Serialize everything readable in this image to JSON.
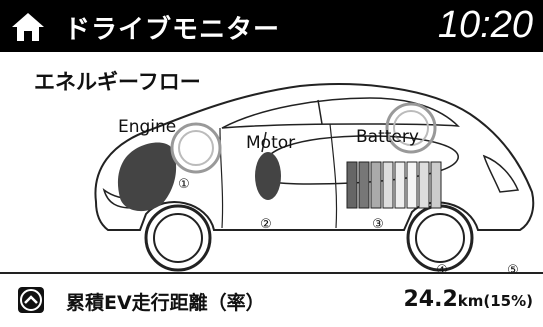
{
  "header": {
    "home_icon": "home-icon",
    "title": "ドライブモニター",
    "clock": "10:20"
  },
  "energy_flow": {
    "title": "エネルギーフロー",
    "labels": {
      "engine": "Engine",
      "motor": "Motor",
      "battery": "Battery"
    },
    "markers": {
      "engine": "①",
      "motor": "②",
      "battery": "③",
      "ev_distance": "④",
      "ev_rate": "⑤"
    }
  },
  "footer": {
    "toggle_icon": "chevron-up-icon",
    "label": "累積EV走行距離（率）",
    "value": "24.2",
    "unit": "km",
    "rate": "(15%)"
  }
}
